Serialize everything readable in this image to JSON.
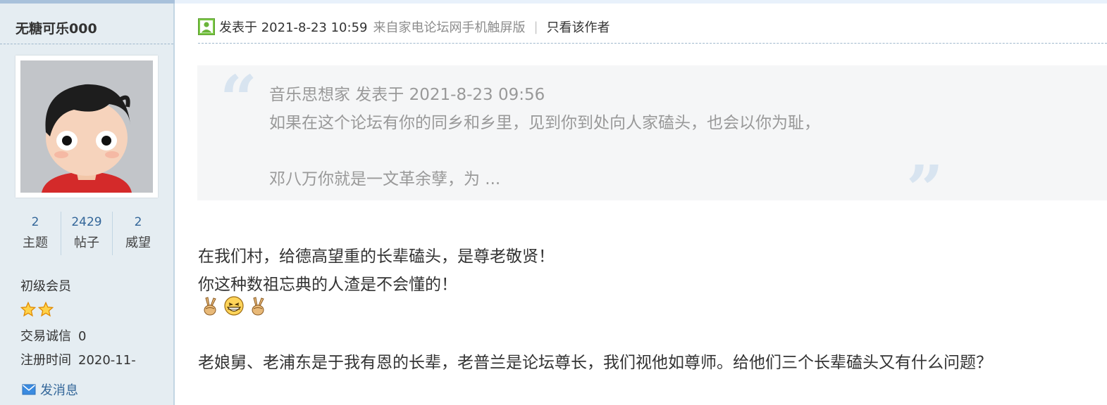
{
  "author": {
    "name": "无糖可乐000",
    "stats": [
      {
        "value": "2",
        "label": "主题"
      },
      {
        "value": "2429",
        "label": "帖子"
      },
      {
        "value": "2",
        "label": "威望"
      }
    ],
    "level": "初级会员",
    "star_count": 2,
    "trade_label": "交易诚信",
    "trade_value": "0",
    "register_label": "注册时间",
    "register_value": "2020-11-",
    "send_message": "发消息"
  },
  "post": {
    "posted_at": "发表于 2021-8-23 10:59",
    "source": "来自家电论坛网手机触屏版",
    "separator": "|",
    "only_author": "只看该作者",
    "quote": {
      "header": "音乐思想家 发表于 2021-8-23 09:56",
      "line1": "如果在这个论坛有你的同乡和乡里，见到你到处向人家磕头，也会以你为耻，",
      "line2": "邓八万你就是一文革余孽，为 ..."
    },
    "body": {
      "line1": "在我们村，给德高望重的长辈磕头，是尊老敬贤！",
      "line2": "你这种数祖忘典的人渣是不会懂的！",
      "line3": "老娘舅、老浦东是于我有恩的长辈，老普兰是论坛尊长，我们视他如尊师。给他们三个长辈磕头又有什么问题？"
    },
    "emojis": [
      "victory-hand-icon",
      "grinning-face-icon",
      "victory-hand-icon"
    ]
  },
  "colors": {
    "sidebar_bg": "#e5edf2",
    "link": "#336699",
    "quote_text": "#999999",
    "quote_bg": "#f5f6f7"
  }
}
